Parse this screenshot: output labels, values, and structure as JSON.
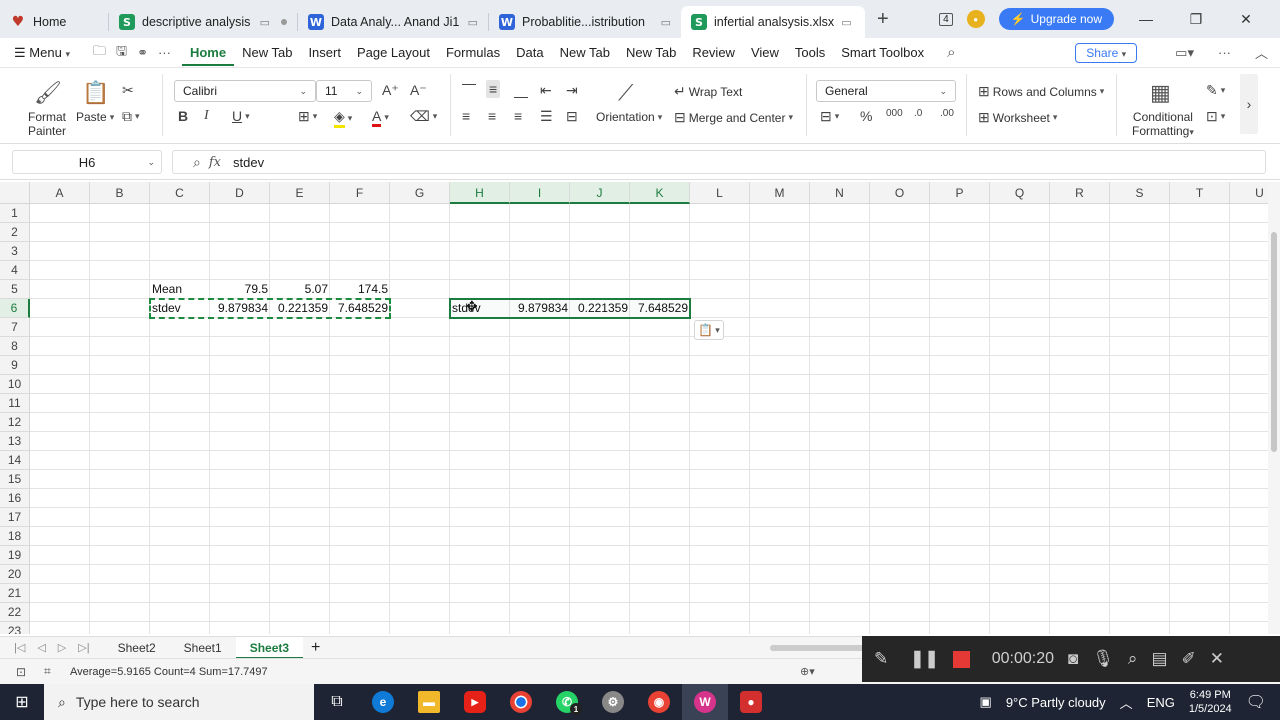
{
  "window_tabs": [
    {
      "label": "Home",
      "icon": "wps-home-icon"
    },
    {
      "label": "descriptive analysis",
      "icon": "spreadsheet-icon"
    },
    {
      "label": "Data Analy... Anand Ji1",
      "icon": "writer-icon"
    },
    {
      "label": "Probablitie...istribution",
      "icon": "writer-icon"
    },
    {
      "label": "infertial analsysis.xlsx",
      "icon": "spreadsheet-icon",
      "active": true
    }
  ],
  "tab_icons": {
    "sheet": "S",
    "writer": "W",
    "home": "♥"
  },
  "window_badge": "4",
  "upgrade_label": "Upgrade now",
  "menu_label": "Menu",
  "menus": [
    "Home",
    "New Tab",
    "Insert",
    "Page Layout",
    "Formulas",
    "Data",
    "New Tab",
    "New Tab",
    "Review",
    "View",
    "Tools",
    "Smart Toolbox"
  ],
  "share_label": "Share",
  "ribbon": {
    "format_painter": [
      "Format",
      "Painter"
    ],
    "paste": "Paste",
    "font_name": "Calibri",
    "font_size": "11",
    "orientation": "Orientation",
    "wrap_text": "Wrap Text",
    "merge_center": "Merge and Center",
    "number_format": "General",
    "rows_columns": "Rows and Columns",
    "worksheet": "Worksheet",
    "conditional_formatting": [
      "Conditional",
      "Formatting"
    ]
  },
  "name_box": "H6",
  "fx_label": "fx",
  "formula": "stdev",
  "columns": [
    "A",
    "B",
    "C",
    "D",
    "E",
    "F",
    "G",
    "H",
    "I",
    "J",
    "K",
    "L",
    "M",
    "N",
    "O",
    "P",
    "Q",
    "R",
    "S",
    "T",
    "U"
  ],
  "rows": [
    "1",
    "2",
    "3",
    "4",
    "5",
    "6",
    "7",
    "8",
    "9",
    "10",
    "11",
    "12",
    "13",
    "14",
    "15",
    "16",
    "17",
    "18",
    "19",
    "20",
    "21",
    "22",
    "23"
  ],
  "cells": {
    "C5": "Mean",
    "D5": "79.5",
    "E5": "5.07",
    "F5": "174.5",
    "C6": "stdev",
    "D6": "9.879834",
    "E6": "0.221359",
    "F6": "7.648529",
    "H6": "stdev",
    "I6": "9.879834",
    "J6": "0.221359",
    "K6": "7.648529"
  },
  "sheets": [
    "Sheet2",
    "Sheet1",
    "Sheet3"
  ],
  "active_sheet": "Sheet3",
  "status": "Average=5.9165  Count=4  Sum=17.7497",
  "recorder_time": "00:00:20",
  "taskbar": {
    "search_placeholder": "Type here to search",
    "weather": "9°C  Partly cloudy",
    "lang": "ENG",
    "time": "6:49 PM",
    "date": "1/5/2024",
    "whatsapp_badge": "1"
  },
  "colors": {
    "accent": "#1c7c3f",
    "upgrade": "#3a7bf5",
    "recorder_stop": "#e53935"
  }
}
